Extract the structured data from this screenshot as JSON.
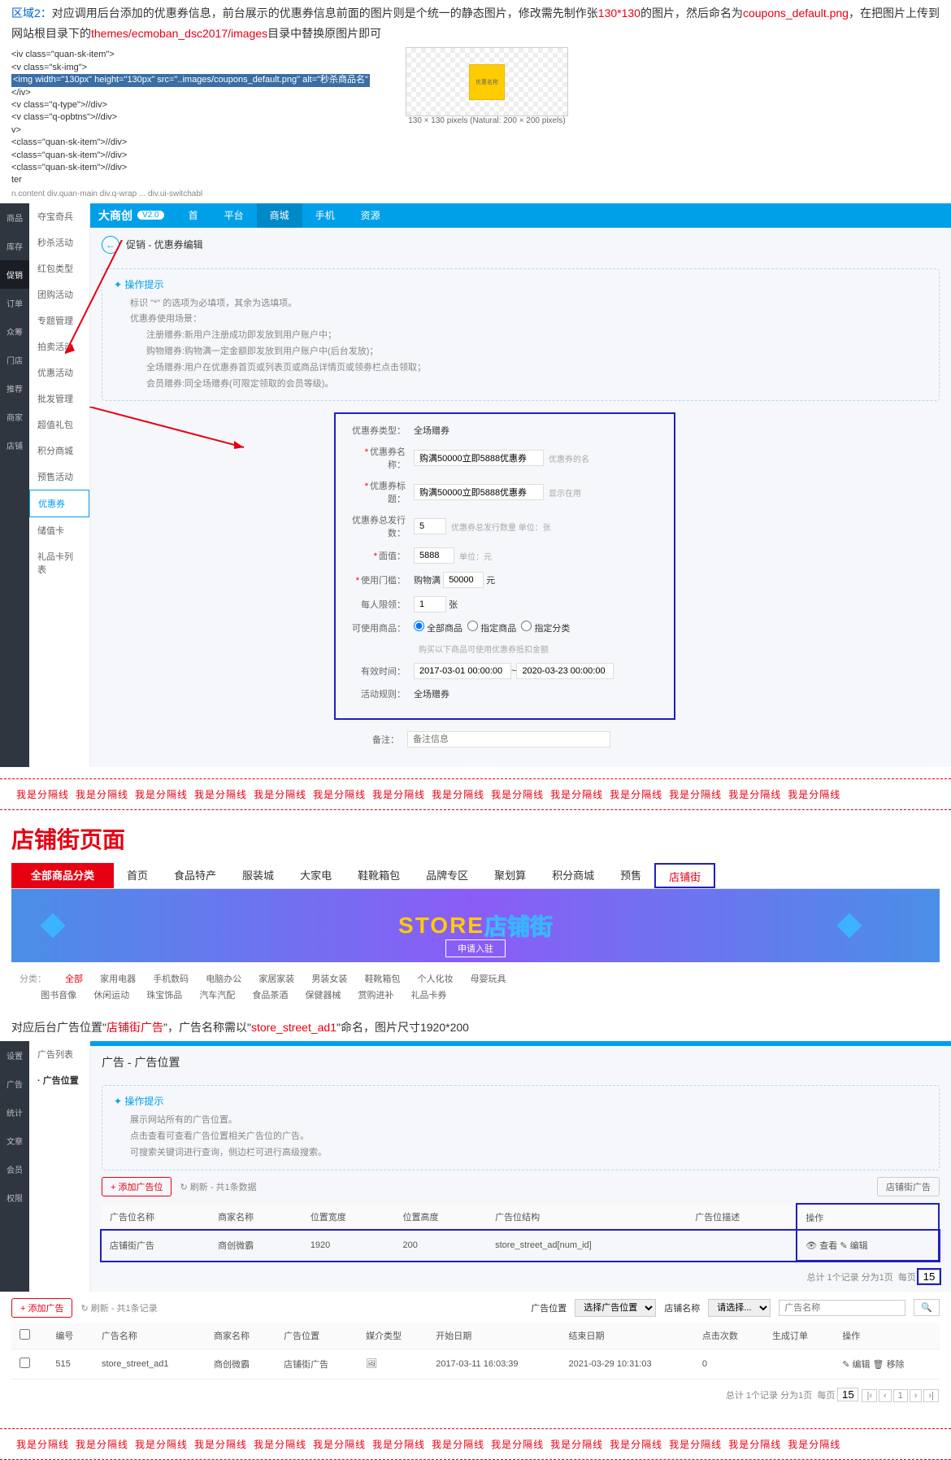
{
  "intro": {
    "p1a": "区域2：",
    "p1b": "对应调用后台添加的优惠券信息，前台展示的优惠券信息前面的图片则是个统一的静态图片，修改需先制作张",
    "p1c": "130*130",
    "p1d": "的图片，然后命名为",
    "p1e": "coupons_default.png",
    "p1f": "，在把图片上传到网站根目录下的",
    "p1g": "themes/ecmoban_dsc2017/images",
    "p1h": "目录中替换原图片即可"
  },
  "code": {
    "l1": "<iv class=\"quan-sk-item\">",
    "l2": " <v class=\"sk-img\">",
    "l3": "  <img width=\"130px\" height=\"130px\" src=\"..images/coupons_default.png\" alt=\"秒杀商品名\"",
    "l4": "</iv>",
    "l5": "<v class=\"q-type\">//div>",
    "l6": "<v class=\"q-opbtns\">//div>",
    "l7": "v>",
    "l8": " <class=\"quan-sk-item\">//div>",
    "l9": " <class=\"quan-sk-item\">//div>",
    "l10": " <class=\"quan-sk-item\">//div>",
    "l11": "ter",
    "thumb_label": "130 × 130 pixels (Natural: 200 × 200 pixels)",
    "thumb_inner": "优惠名称",
    "path": "n.content   div.quan-main   div.q-wrap   ...   div.ui-switchabl"
  },
  "divider": [
    "我是分隔线",
    "我是分隔线",
    "我是分隔线",
    "我是分隔线",
    "我是分隔线",
    "我是分隔线",
    "我是分隔线",
    "我是分隔线",
    "我是分隔线",
    "我是分隔线",
    "我是分隔线",
    "我是分隔线",
    "我是分隔线",
    "我是分隔线"
  ],
  "admin1": {
    "logo": "大商创",
    "ver": "V2.0",
    "tabs": [
      "首",
      "平台",
      "商城",
      "手机",
      "资源"
    ],
    "left": [
      "商品",
      "库存",
      "促销",
      "订单",
      "众筹",
      "门店",
      "推荐",
      "商家",
      "店铺"
    ],
    "subnav": [
      "夺宝奇兵",
      "秒杀活动",
      "红包类型",
      "团购活动",
      "专题管理",
      "拍卖活动",
      "优惠活动",
      "批发管理",
      "超值礼包",
      "积分商城",
      "预售活动",
      "优惠券",
      "储值卡",
      "礼品卡列表"
    ],
    "crumb": "促销 - 优惠券编辑",
    "tip_head": "操作提示",
    "tips": [
      "标识 \"*\" 的选项为必填项，其余为选填项。",
      "优惠券使用场景：",
      "注册赠券:新用户注册成功即发放到用户账户中；",
      "购物赠券:购物满一定金额即发放到用户账户中(后台发放)；",
      "全场赠券:用户在优惠券首页或列表页或商品详情页或领劵栏点击领取；",
      "会员赠券:同全场赠券(可限定领取的会员等级)。"
    ],
    "form": {
      "type_lab": "优惠券类型：",
      "type_val": "全场赠券",
      "name_lab": "优惠券名称：",
      "name_val": "购满50000立即5888优惠券",
      "name_hint": "优惠券的名",
      "title_lab": "优惠券标题：",
      "title_val": "购满50000立即5888优惠券",
      "title_hint": "显示在用",
      "total_lab": "优惠券总发行数：",
      "total_val": "5",
      "total_hint": "优惠券总发行数量 单位：张",
      "face_lab": "面值：",
      "face_val": "5888",
      "face_hint": "单位：元",
      "cond_lab": "使用门槛：",
      "cond_pre": "购物满",
      "cond_val": "50000",
      "cond_unit": "元",
      "per_lab": "每人限领：",
      "per_val": "1",
      "per_unit": "张",
      "goods_lab": "可使用商品：",
      "goods_opts": [
        "全部商品",
        "指定商品",
        "指定分类"
      ],
      "goods_hint": "购买以下商品可使用优惠券抵扣金额",
      "time_lab": "有效时间：",
      "time_from": "2017-03-01 00:00:00",
      "time_to": "2020-03-23 00:00:00",
      "scope_lab": "活动规则：",
      "scope_val": "全场赠券",
      "remark_lab": "备注：",
      "remark_ph": "备注信息"
    }
  },
  "section_title": "店铺街页面",
  "nav2": {
    "cats": "全部商品分类",
    "tabs": [
      "首页",
      "食品特产",
      "服装城",
      "大家电",
      "鞋靴箱包",
      "品牌专区",
      "聚划算",
      "积分商城",
      "预售",
      "店铺街"
    ]
  },
  "banner": {
    "t1": "STORE",
    "t2": "店铺街",
    "btn": "申请入驻"
  },
  "cats2": {
    "label": "分类：",
    "row1": [
      "全部",
      "家用电器",
      "手机数码",
      "电脑办公",
      "家居家装",
      "男装女装",
      "鞋靴箱包",
      "个人化妆",
      "母婴玩具"
    ],
    "row2": [
      "图书音像",
      "休闲运动",
      "珠宝饰品",
      "汽车汽配",
      "食品茶酒",
      "保健器械",
      "赏购进补",
      "礼品卡券"
    ]
  },
  "desc2": {
    "a": "对应后台广告位置\"",
    "b": "店铺街广告",
    "c": "\"，广告名称需以\"",
    "d": "store_street_ad1",
    "e": "\"命名，图片尺寸1920*200"
  },
  "admin2": {
    "left": [
      "设置",
      "广告",
      "统计",
      "文章",
      "会员",
      "权限"
    ],
    "subnav": [
      "广告列表",
      "广告位置"
    ],
    "crumb": "广告 - 广告位置",
    "tip_head": "操作提示",
    "tips": [
      "展示网站所有的广告位置。",
      "点击查看可查看广告位置相关广告位的广告。",
      "可搜索关键词进行查询，侧边栏可进行高级搜索。"
    ],
    "btn_add": "+ 添加广告位",
    "refresh": "刷新 - 共1条数据",
    "btn_right": "店铺街广告",
    "th": [
      "广告位名称",
      "商家名称",
      "位置宽度",
      "位置高度",
      "广告位结构",
      "广告位描述",
      "操作"
    ],
    "row": {
      "name": "店铺街广告",
      "shop": "商创微霸",
      "w": "1920",
      "h": "200",
      "struct": "store_street_ad[num_id]",
      "desc": "",
      "op1": "查看",
      "op2": "编辑"
    },
    "pager": "总计 1个记录 分为1页",
    "pager_lab": "每页",
    "pager_val": "15"
  },
  "admin3": {
    "btn_add": "+ 添加广告",
    "refresh": "刷新 - 共1条记录",
    "pos_lab": "广告位置",
    "pos_ph": "选择广告位置",
    "shop_lab": "店铺名称",
    "shop_ph": "请选择...",
    "search_ph": "广告名称",
    "th": [
      "",
      "编号",
      "广告名称",
      "商家名称",
      "广告位置",
      "媒介类型",
      "开始日期",
      "结束日期",
      "点击次数",
      "生成订单",
      "操作"
    ],
    "row": {
      "id": "515",
      "name": "store_street_ad1",
      "shop": "商创微霸",
      "pos": "店铺街广告",
      "media": "",
      "start": "2017-03-11 16:03:39",
      "end": "2021-03-29 10:31:03",
      "clicks": "0",
      "orders": "",
      "op1": "编辑",
      "op2": "移除"
    },
    "pager": "总计 1个记录 分为1页",
    "pager_lab": "每页",
    "pager_val": "15"
  }
}
